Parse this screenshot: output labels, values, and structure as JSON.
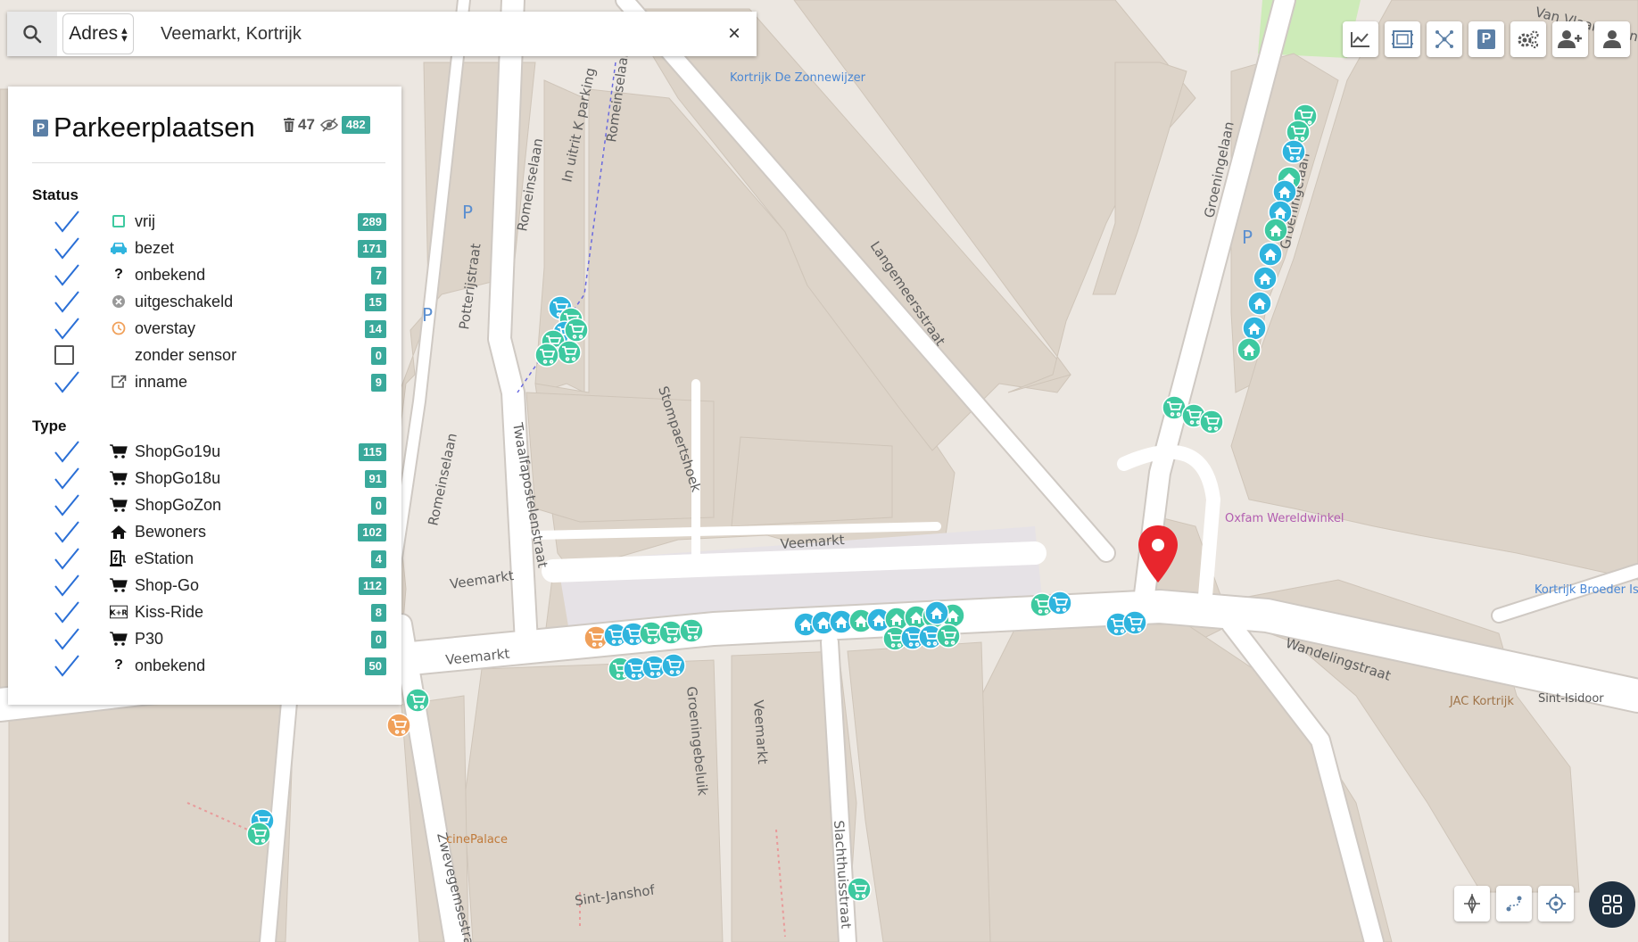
{
  "search": {
    "mode": "Adres",
    "value": "Veemarkt, Kortrijk",
    "clear_label": "×"
  },
  "legend": {
    "title": "Parkeerplaatsen",
    "deleted_count": "47",
    "visible_count": "482",
    "status_heading": "Status",
    "status_items": [
      {
        "label": "vrij",
        "count": "289",
        "checked": true,
        "icon": "empty-square-icon"
      },
      {
        "label": "bezet",
        "count": "171",
        "checked": true,
        "icon": "car-icon"
      },
      {
        "label": "onbekend",
        "count": "7",
        "checked": true,
        "icon": "question-icon"
      },
      {
        "label": "uitgeschakeld",
        "count": "15",
        "checked": true,
        "icon": "disabled-circle-icon"
      },
      {
        "label": "overstay",
        "count": "14",
        "checked": true,
        "icon": "clock-icon"
      },
      {
        "label": "zonder sensor",
        "count": "0",
        "checked": false,
        "icon": ""
      },
      {
        "label": "inname",
        "count": "9",
        "checked": true,
        "icon": "external-link-icon"
      }
    ],
    "type_heading": "Type",
    "type_items": [
      {
        "label": "ShopGo19u",
        "count": "115",
        "checked": true,
        "icon": "cart-icon"
      },
      {
        "label": "ShopGo18u",
        "count": "91",
        "checked": true,
        "icon": "cart-icon"
      },
      {
        "label": "ShopGoZon",
        "count": "0",
        "checked": true,
        "icon": "cart-icon"
      },
      {
        "label": "Bewoners",
        "count": "102",
        "checked": true,
        "icon": "home-icon"
      },
      {
        "label": "eStation",
        "count": "4",
        "checked": true,
        "icon": "charging-station-icon"
      },
      {
        "label": "Shop-Go",
        "count": "112",
        "checked": true,
        "icon": "cart-icon"
      },
      {
        "label": "Kiss-Ride",
        "count": "8",
        "checked": true,
        "icon": "kiss-ride-icon"
      },
      {
        "label": "P30",
        "count": "0",
        "checked": true,
        "icon": "cart-icon"
      },
      {
        "label": "onbekend",
        "count": "50",
        "checked": true,
        "icon": "question-icon"
      }
    ]
  },
  "toolbar": [
    "chart-icon",
    "map-frame-icon",
    "cluster-icon",
    "parking-icon",
    "settings-icon",
    "add-user-icon",
    "user-icon"
  ],
  "map_controls": [
    "locate-target-icon",
    "route-icon",
    "crosshair-icon",
    "grid-icon"
  ],
  "map_labels": {
    "streets": [
      "Veemarkt",
      "Veemarkt",
      "Veemarkt",
      "Romeinselaan",
      "Romeinselaan",
      "Romeinselaan",
      "In uitrit K parking",
      "Potterijstraat",
      "Langemeersstraat",
      "Stompaertshoek",
      "Twaalfapostelenstraat",
      "Groeningelaan",
      "Groeningelaan",
      "Wandelingstraat",
      "Groeningebeluik",
      "Veemarkt",
      "Slachthuisstraat",
      "Zwevegemsestraat",
      "Sint-Janshof",
      "Van Vlaanderen"
    ],
    "pois": [
      "Kortrijk De Zonnewijzer",
      "Oxfam Wereldwinkel",
      "Kortrijk Broeder Isidoor",
      "Sint-Isidoor",
      "JAC Kortrijk",
      "cinePalace"
    ]
  },
  "colors": {
    "free": "#3ec9a0",
    "occupied": "#2fb4de",
    "overstay": "#f0a05a",
    "badge": "#3aa99b",
    "pin": "#e8262d",
    "check": "#2a6fd6",
    "building": "#ddd4c9",
    "road": "#ffffff"
  }
}
